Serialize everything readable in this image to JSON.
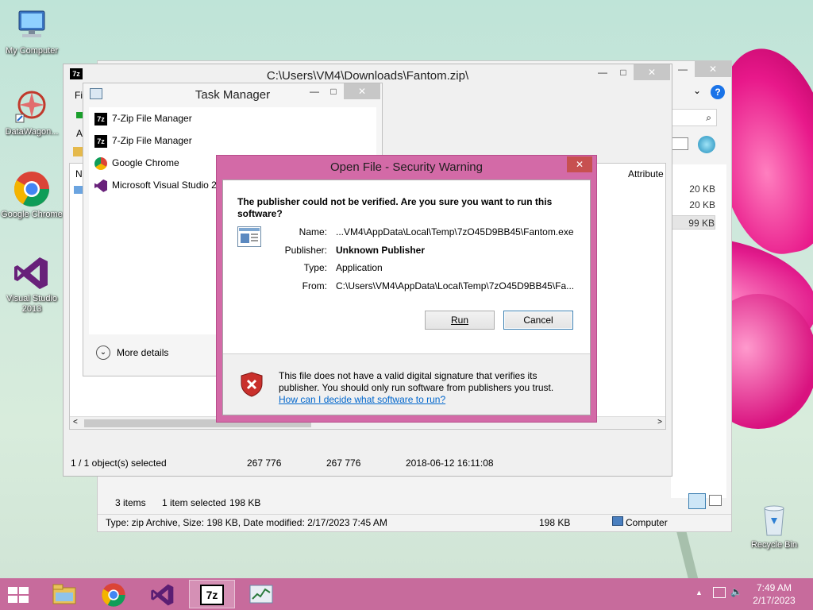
{
  "desktop": {
    "icons": [
      {
        "label": "My Computer"
      },
      {
        "label": "DataWagon..."
      },
      {
        "label": "Google Chrome"
      },
      {
        "label": "Visual Studio 2013"
      },
      {
        "label": "Recycle Bin"
      }
    ]
  },
  "explorer": {
    "status_items": "3 items",
    "status_selected": "1 item selected",
    "status_size": "198 KB",
    "details_line": "Type: zip Archive, Size: 198 KB, Date modified: 2/17/2023 7:45 AM",
    "details_size": "198 KB",
    "details_location": "Computer",
    "sizes": [
      "20 KB",
      "20 KB",
      "99 KB"
    ],
    "column_attributes": "Attribute"
  },
  "sevenzip": {
    "title": "C:\\Users\\VM4\\Downloads\\Fantom.zip\\",
    "menu_fragment": "Fil",
    "toolbar_fragment": "A",
    "list_fragment": "N",
    "status": {
      "selected": "1 / 1 object(s) selected",
      "size": "267 776",
      "packed": "267 776",
      "modified": "2018-06-12 16:11:08"
    }
  },
  "taskmanager": {
    "title": "Task Manager",
    "items": [
      {
        "label": "7-Zip File Manager",
        "icon": "7zip-icon"
      },
      {
        "label": "7-Zip File Manager",
        "icon": "7zip-icon"
      },
      {
        "label": "Google Chrome",
        "icon": "chrome-icon"
      },
      {
        "label": "Microsoft Visual Studio 2",
        "icon": "visual-studio-icon"
      }
    ],
    "more_details": "More details"
  },
  "dialog": {
    "title": "Open File - Security Warning",
    "question": "The publisher could not be verified.  Are you sure you want to run this software?",
    "fields": {
      "name_label": "Name:",
      "name_value": "...VM4\\AppData\\Local\\Temp\\7zO45D9BB45\\Fantom.exe",
      "publisher_label": "Publisher:",
      "publisher_value": "Unknown Publisher",
      "type_label": "Type:",
      "type_value": "Application",
      "from_label": "From:",
      "from_value": "C:\\Users\\VM4\\AppData\\Local\\Temp\\7zO45D9BB45\\Fa..."
    },
    "run_label": "Run",
    "cancel_label": "Cancel",
    "warning_text": "This file does not have a valid digital signature that verifies its publisher.  You should only run software from publishers you trust.",
    "help_link": "How can I decide what software to run?",
    "colors": {
      "frame": "#d36aa7",
      "link": "#0066cc"
    }
  },
  "taskbar": {
    "time": "7:49 AM",
    "date": "2/17/2023",
    "apps": [
      "file-explorer-icon",
      "chrome-icon",
      "visual-studio-icon",
      "7zip-icon",
      "task-manager-icon"
    ],
    "color": "#c76b9c"
  }
}
